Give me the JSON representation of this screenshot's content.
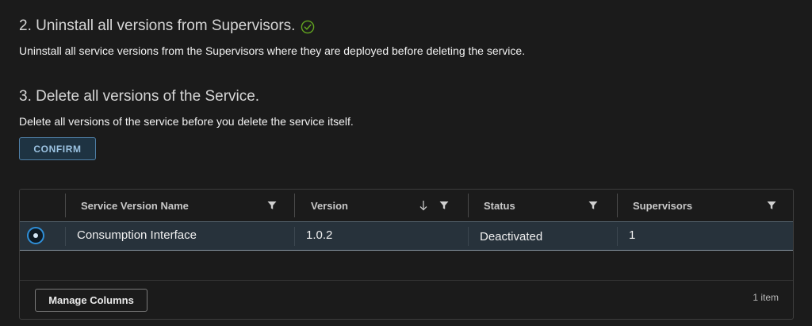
{
  "step2": {
    "title": "2. Uninstall all versions from Supervisors.",
    "description": "Uninstall all service versions from the Supervisors where they are deployed before deleting the service.",
    "status_icon": "check-circle-icon"
  },
  "step3": {
    "title": "3. Delete all versions of the Service.",
    "description": "Delete all versions of the service before you delete the service itself.",
    "confirm_label": "CONFIRM"
  },
  "grid": {
    "columns": [
      {
        "label": "Service Version Name",
        "filter": true,
        "sort": false
      },
      {
        "label": "Version",
        "filter": true,
        "sort": "descending"
      },
      {
        "label": "Status",
        "filter": true,
        "sort": false
      },
      {
        "label": "Supervisors",
        "filter": true,
        "sort": false
      }
    ],
    "rows": [
      {
        "selected": true,
        "service_version_name": "Consumption Interface",
        "version": "1.0.2",
        "status": "Deactivated",
        "supervisors": "1"
      }
    ],
    "footer": {
      "manage_columns_label": "Manage Columns",
      "item_count": "1 item"
    }
  },
  "colors": {
    "background": "#1b1b1b",
    "success": "#62a420",
    "accent": "#2f8fd8",
    "selected_row": "#27323b",
    "button_border": "#4f7fa6"
  }
}
